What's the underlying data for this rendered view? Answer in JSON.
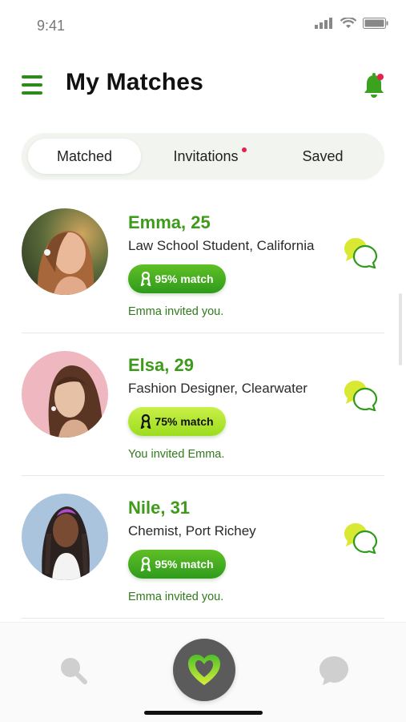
{
  "status": {
    "time": "9:41"
  },
  "header": {
    "title": "My Matches"
  },
  "tabs": [
    {
      "label": "Matched",
      "active": true
    },
    {
      "label": "Invitations",
      "active": false,
      "has_dot": true
    },
    {
      "label": "Saved",
      "active": false
    }
  ],
  "matches": [
    {
      "name": "Emma, 25",
      "role": "Law School Student, California",
      "match": "95% match",
      "note": "Emma invited you.",
      "badge_style": "green"
    },
    {
      "name": "Elsa, 29",
      "role": "Fashion Designer, Clearwater",
      "match": "75% match",
      "note": "You invited Emma.",
      "badge_style": "lime"
    },
    {
      "name": "Nile, 31",
      "role": "Chemist, Port Richey",
      "match": "95% match",
      "note": "Emma invited you.",
      "badge_style": "green"
    }
  ],
  "colors": {
    "brand_green": "#3e9a1a",
    "accent_lime": "#c9f046",
    "notification": "#e8204d"
  },
  "icons": {
    "menu": "hamburger-icon",
    "bell": "bell-icon",
    "chat": "chat-bubbles-icon",
    "search": "search-icon",
    "heart": "heart-icon",
    "ribbon": "ribbon-icon"
  }
}
